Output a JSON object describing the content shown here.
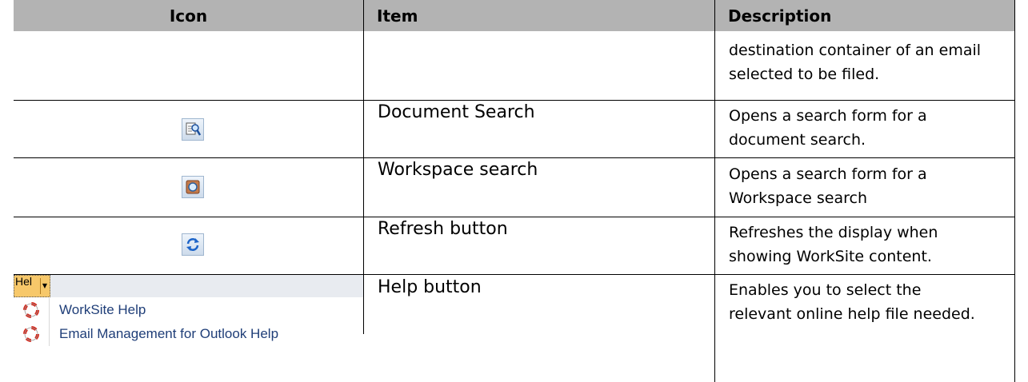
{
  "table": {
    "headers": {
      "icon": "Icon",
      "item": "Item",
      "description": "Description"
    },
    "rows": [
      {
        "icon": "",
        "item": "",
        "description_lines": [
          "destination container of an email",
          "selected to be filed."
        ]
      },
      {
        "icon": "document-search-icon",
        "item": "Document Search",
        "description_lines": [
          "Opens a search form for a",
          "document search."
        ]
      },
      {
        "icon": "workspace-search-icon",
        "item": "Workspace search",
        "description_lines": [
          "Opens a search form for a",
          "Workspace search"
        ]
      },
      {
        "icon": "refresh-icon",
        "item": "Refresh button",
        "description_lines": [
          "Refreshes the display when",
          "showing WorkSite content."
        ]
      },
      {
        "icon": "help-dropdown-icon",
        "item": "Help button",
        "description_lines": [
          "Enables you to select the",
          "relevant online help file needed."
        ]
      }
    ]
  },
  "help_menu": {
    "button_label": "Hel",
    "items": [
      "WorkSite Help",
      "Email Management for Outlook Help"
    ]
  },
  "colors": {
    "header_bg": "#b3b3b3",
    "menu_text": "#1f3e78",
    "help_button_bg": "#f7c86a",
    "lifebuoy_red": "#d62a1e"
  }
}
